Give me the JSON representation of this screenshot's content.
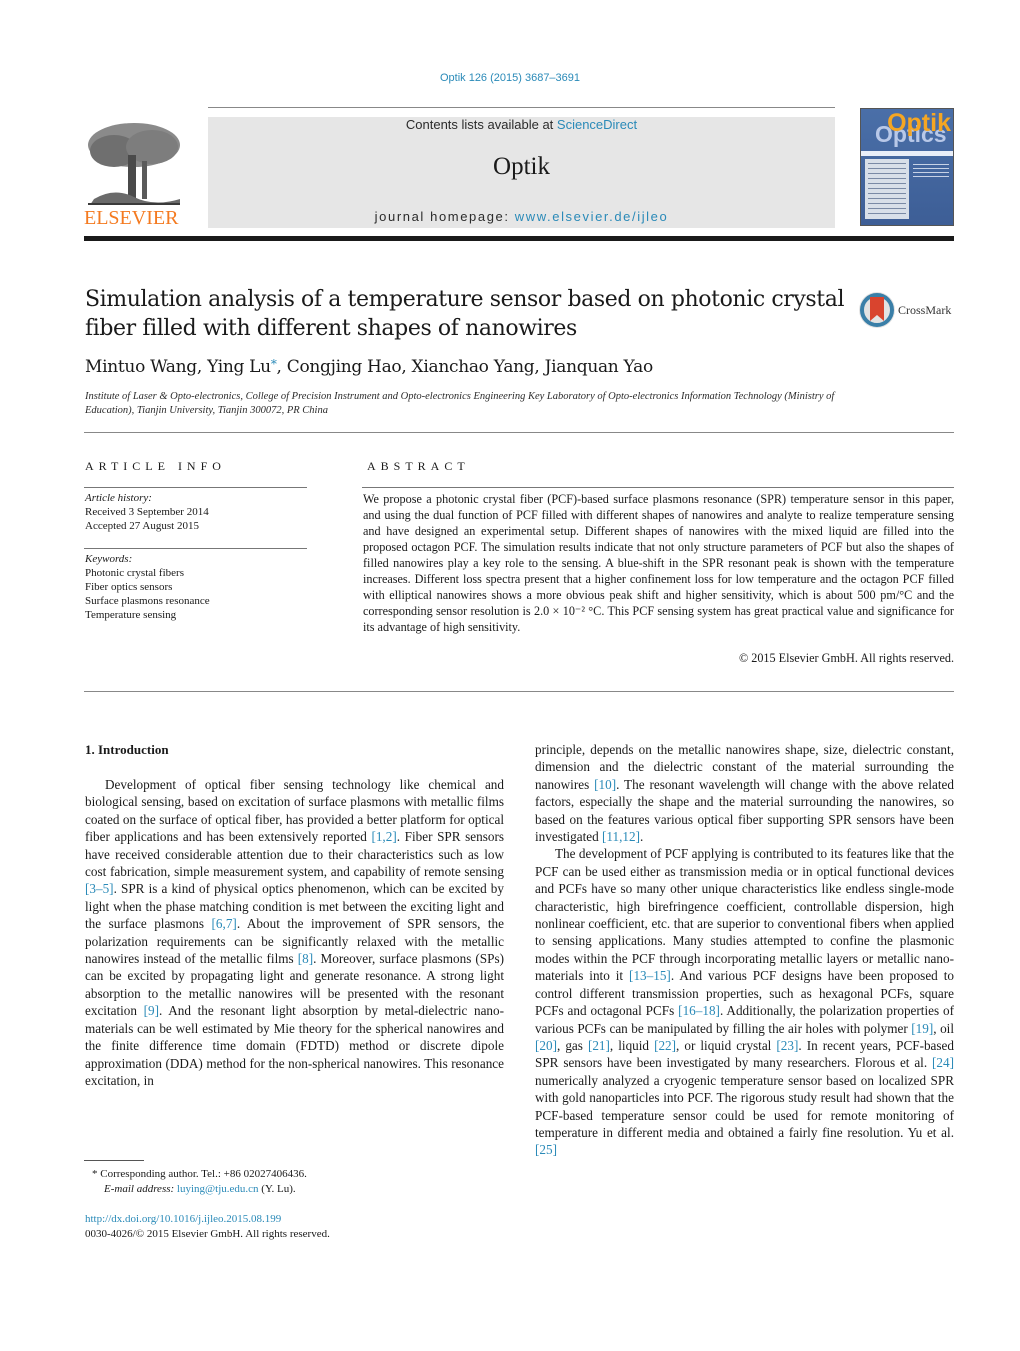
{
  "header": {
    "journal_ref": "Optik 126 (2015) 3687–3691",
    "publisher_logo_label": "ELSEVIER",
    "contents_prefix": "Contents lists available at ",
    "contents_link": "ScienceDirect",
    "journal_title": "Optik",
    "homepage_prefix": "journal homepage: ",
    "homepage_link": "www.elsevier.de/ijleo",
    "cover_title_top": "Optik",
    "cover_title_bottom": "Optics"
  },
  "article": {
    "title": "Simulation analysis of a temperature sensor based on photonic crystal fiber filled with different shapes of nanowires",
    "crossmark_label": "CrossMark",
    "authors_before_star": "Mintuo Wang, Ying Lu",
    "author_star": "*",
    "authors_after_star": ", Congjing Hao, Xianchao Yang, Jianquan Yao",
    "affiliation": "Institute of Laser & Opto-electronics, College of Precision Instrument and Opto-electronics Engineering Key Laboratory of Opto-electronics Information Technology (Ministry of Education), Tianjin University, Tianjin 300072, PR China"
  },
  "article_info": {
    "heading": "ARTICLE INFO",
    "history_label": "Article history:",
    "received": "Received 3 September 2014",
    "accepted": "Accepted 27 August 2015",
    "keywords_label": "Keywords:",
    "keywords": [
      "Photonic crystal fibers",
      "Fiber optics sensors",
      "Surface plasmons resonance",
      "Temperature sensing"
    ]
  },
  "abstract": {
    "heading": "ABSTRACT",
    "text": "We propose a photonic crystal fiber (PCF)-based surface plasmons resonance (SPR) temperature sensor in this paper, and using the dual function of PCF filled with different shapes of nanowires and analyte to realize temperature sensing and have designed an experimental setup. Different shapes of nanowires with the mixed liquid are filled into the proposed octagon PCF. The simulation results indicate that not only structure parameters of PCF but also the shapes of filled nanowires play a key role to the sensing. A blue-shift in the SPR resonant peak is shown with the temperature increases. Different loss spectra present that a higher confinement loss for low temperature and the octagon PCF filled with elliptical nanowires shows a more obvious peak shift and higher sensitivity, which is about 500 pm/°C and the corresponding sensor resolution is 2.0 × 10⁻² °C. This PCF sensing system has great practical value and significance for its advantage of high sensitivity.",
    "copyright": "© 2015 Elsevier GmbH. All rights reserved."
  },
  "body": {
    "section_heading": "1.  Introduction",
    "left_column": [
      {
        "t": "Development of optical fiber sensing technology like chemical and biological sensing, based on excitation of surface plasmons with metallic films coated on the surface of optical fiber, has provided a better platform for optical fiber applications and has been extensively reported "
      },
      {
        "ref": "[1,2]"
      },
      {
        "t": ". Fiber SPR sensors have received considerable attention due to their characteristics such as low cost fabrication, simple measurement system, and capability of remote sensing "
      },
      {
        "ref": "[3–5]"
      },
      {
        "t": ". SPR is a kind of physical optics phenomenon, which can be excited by light when the phase matching condition is met between the exciting light and the surface plasmons "
      },
      {
        "ref": "[6,7]"
      },
      {
        "t": ". About the improvement of SPR sensors, the polarization requirements can be significantly relaxed with the metallic nanowires instead of the metallic films "
      },
      {
        "ref": "[8]"
      },
      {
        "t": ". Moreover, surface plasmons (SPs) can be excited by propagating light and generate resonance. A strong light absorption to the metallic nanowires will be presented with the resonant excitation "
      },
      {
        "ref": "[9]"
      },
      {
        "t": ". And the resonant light absorption by metal-dielectric nano-materials can be well estimated by Mie theory for the spherical nanowires and the finite difference time domain (FDTD) method or discrete dipole approximation (DDA) method for the non-spherical nanowires. This resonance excitation, in"
      }
    ],
    "right_column_p1": [
      {
        "t": "principle, depends on the metallic nanowires shape, size, dielectric constant, dimension and the dielectric constant of the material surrounding the nanowires "
      },
      {
        "ref": "[10]"
      },
      {
        "t": ". The resonant wavelength will change with the above related factors, especially the shape and the material surrounding the nanowires, so based on the features various optical fiber supporting SPR sensors have been investigated "
      },
      {
        "ref": "[11,12]"
      },
      {
        "t": "."
      }
    ],
    "right_column_p2": [
      {
        "t": "The development of PCF applying is contributed to its features like that the PCF can be used either as transmission media or in optical functional devices and PCFs have so many other unique characteristics like endless single-mode characteristic, high birefringence coefficient, controllable dispersion, high nonlinear coefficient, etc. that are superior to conventional fibers when applied to sensing applications. Many studies attempted to confine the plasmonic modes within the PCF through incorporating metallic layers or metallic nano-materials into it "
      },
      {
        "ref": "[13–15]"
      },
      {
        "t": ". And various PCF designs have been proposed to control different transmission properties, such as hexagonal PCFs, square PCFs and octagonal PCFs "
      },
      {
        "ref": "[16–18]"
      },
      {
        "t": ". Additionally, the polarization properties of various PCFs can be manipulated by filling the air holes with polymer "
      },
      {
        "ref": "[19]"
      },
      {
        "t": ", oil "
      },
      {
        "ref": "[20]"
      },
      {
        "t": ", gas "
      },
      {
        "ref": "[21]"
      },
      {
        "t": ", liquid "
      },
      {
        "ref": "[22]"
      },
      {
        "t": ", or liquid crystal "
      },
      {
        "ref": "[23]"
      },
      {
        "t": ". In recent years, PCF-based SPR sensors have been investigated by many researchers. Florous et al. "
      },
      {
        "ref": "[24]"
      },
      {
        "t": " numerically analyzed a cryogenic temperature sensor based on localized SPR with gold nanoparticles into PCF. The rigorous study result had shown that the PCF-based temperature sensor could be used for remote monitoring of temperature in different media and obtained a fairly fine resolution. Yu et al. "
      },
      {
        "ref": "[25]"
      }
    ]
  },
  "footnote": {
    "star": "*",
    "corresponding": "Corresponding author. Tel.: +86 02027406436.",
    "email_label": "E-mail address:",
    "email": "luying@tju.edu.cn",
    "email_suffix": " (Y. Lu).",
    "doi": "http://dx.doi.org/10.1016/j.ijleo.2015.08.199",
    "issn": "0030-4026/© 2015 Elsevier GmbH. All rights reserved."
  },
  "colors": {
    "link": "#2a8ab8",
    "elsevier_orange": "#f47a20",
    "header_box": "#e6e6e6"
  }
}
